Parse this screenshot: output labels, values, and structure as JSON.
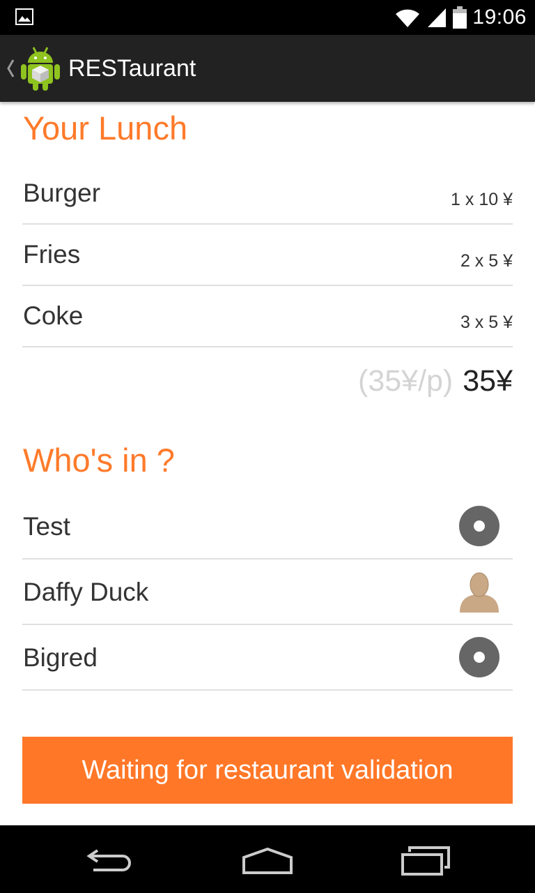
{
  "status_bar": {
    "time": "19:06",
    "left_icon": "picture-notification-icon",
    "right_icons": [
      "wifi-icon",
      "signal-icon",
      "battery-icon"
    ]
  },
  "action_bar": {
    "title": "RESTaurant",
    "icon": "android-app-icon",
    "up_icon": "up-caret-icon"
  },
  "lunch": {
    "title": "Your Lunch",
    "items": [
      {
        "name": "Burger",
        "qty": "1 x 10 ¥"
      },
      {
        "name": "Fries",
        "qty": "2 x 5 ¥"
      },
      {
        "name": "Coke",
        "qty": "3 x 5 ¥"
      }
    ],
    "per_person": "(35¥/p)",
    "total": "35¥"
  },
  "who": {
    "title": "Who's in ?",
    "people": [
      {
        "name": "Test",
        "avatar": "default-avatar-icon"
      },
      {
        "name": "Daffy Duck",
        "avatar": "person-silhouette-icon"
      },
      {
        "name": "Bigred",
        "avatar": "default-avatar-icon"
      }
    ]
  },
  "button": {
    "label": "Waiting for restaurant validation"
  },
  "navigation": {
    "icons": [
      "back-icon",
      "home-icon",
      "recent-apps-icon"
    ]
  },
  "colors": {
    "accent": "#ff7a2a",
    "button": "#ff7727",
    "action_bar": "#222222",
    "divider": "#e0e0e0"
  }
}
